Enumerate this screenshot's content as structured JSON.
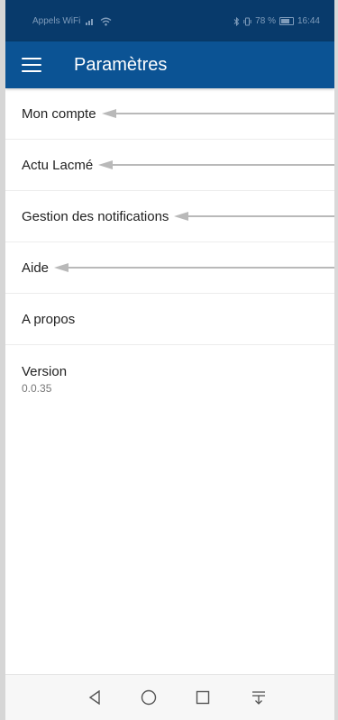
{
  "statusbar": {
    "carrier": "Appels WiFi",
    "right_text": "78 %",
    "time": "16:44"
  },
  "appbar": {
    "title": "Paramètres",
    "menu_icon": "hamburger-menu-icon"
  },
  "settings": {
    "items": [
      {
        "label": "Mon compte"
      },
      {
        "label": "Actu Lacmé"
      },
      {
        "label": "Gestion des notifications"
      },
      {
        "label": "Aide"
      },
      {
        "label": "A propos"
      }
    ],
    "version": {
      "label": "Version",
      "value": "0.0.35"
    }
  },
  "navbar": {
    "icons": [
      "back-triangle-icon",
      "home-circle-icon",
      "recents-square-icon",
      "notification-pull-icon"
    ]
  },
  "colors": {
    "statusbar": "#083a6b",
    "appbar": "#0b5394",
    "arrow": "#b9b9b9"
  }
}
